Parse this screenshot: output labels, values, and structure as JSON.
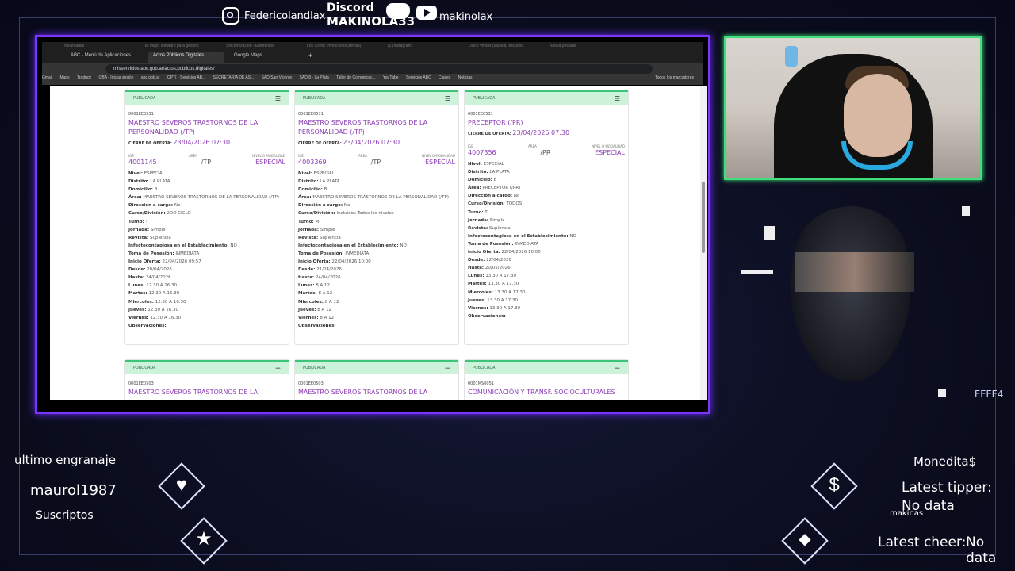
{
  "overlay": {
    "instagram_handle": "Federicolandlax",
    "discord_label": "Discord",
    "discord_handle": "MAKINOLA33",
    "youtube_handle": "makinolax",
    "last_engranaje_label": "ultimo engranaje",
    "last_subscriber": "maurol1987",
    "subscribers_label": "Suscriptos",
    "moneditas_label": "Monedita$",
    "latest_tipper_label": "Latest tipper:",
    "latest_tipper_value": "No data",
    "makinas_label": "makinas",
    "latest_cheer_label": "Latest cheer:",
    "latest_cheer_value": "No data",
    "corner_text": "EEEE4"
  },
  "browser": {
    "tabs": [
      {
        "label": "ABC - Menú de Aplicaciones",
        "active": false
      },
      {
        "label": "Actos Públicos Digitales",
        "active": true
      },
      {
        "label": "Google Maps",
        "active": false
      }
    ],
    "background_tabs": [
      "Novedades",
      "El mejor software para gestión",
      "Sincronización - Elementos",
      "Los Comic Invencibles (temas)",
      "(2) Instagram",
      "Disco Vinilos (Musica) escucha",
      "Nueva pestaña"
    ],
    "new_tab_symbol": "+",
    "url": "misservicios.abc.gob.ar/actos.publicos.digitales/",
    "bookmarks": [
      "Gmail",
      "Maps",
      "Traducir",
      "GBA - Iniciar sesión",
      "abc.gob.ar",
      "OPTI - Servicios AB...",
      "SECRETARÍA DE AS...",
      "SAD San Vicente",
      "SAD 8 - La Plata",
      "Taller de Comunicac...",
      "YouTube",
      "Servicios ABC",
      "Clases",
      "Noticias"
    ],
    "all_bookmarks": "Todos los marcadores"
  },
  "cards": [
    {
      "status": "PUBLICADA",
      "code": "0001EE0531",
      "title": "MAESTRO SEVEROS TRASTORNOS DE LA PERSONALIDAD (/TP)",
      "cierre_label": "CIERRE DE OFERTA:",
      "cierre_date": "23/04/2026 07:30",
      "ige_label": "IGE",
      "area_label": "ÁREA",
      "nivel_label": "NIVEL O MODALIDAD",
      "ige": "4001145",
      "area": "/TP",
      "nivel": "ESPECIAL",
      "details": [
        [
          "Nivel:",
          "ESPECIAL"
        ],
        [
          "Distrito:",
          "LA PLATA"
        ],
        [
          "Domicilio:",
          "B"
        ],
        [
          "Área:",
          "MAESTRO SEVEROS TRASTORNOS DE LA PERSONALIDAD (/TP)"
        ],
        [
          "Dirección a cargo:",
          "No"
        ],
        [
          "Curso/División:",
          "2DO CICLO"
        ],
        [
          "Turno:",
          "T"
        ],
        [
          "Jornada:",
          "Simple"
        ],
        [
          "Revista:",
          "Suplencia"
        ],
        [
          "Infectocontagiosa en el Establecimiento:",
          "NO"
        ],
        [
          "Toma de Posesión:",
          "INMEDIATA"
        ],
        [
          "Inicio Oferta:",
          "22/04/2026 09:57"
        ],
        [
          "Desde:",
          "20/04/2026"
        ],
        [
          "Hasta:",
          "24/04/2026"
        ],
        [
          "Lunes:",
          "12.30 A 16.30"
        ],
        [
          "Martes:",
          "12.30 A 16.30"
        ],
        [
          "Miercoles:",
          "12.30 A 16.30"
        ],
        [
          "Jueves:",
          "12.30 A 16.30"
        ],
        [
          "Viernes:",
          "12.30 A 16.30"
        ],
        [
          "Observaciones:",
          ""
        ]
      ]
    },
    {
      "status": "PUBLICADA",
      "code": "0001EE0531",
      "title": "MAESTRO SEVEROS TRASTORNOS DE LA PERSONALIDAD (/TP)",
      "cierre_label": "CIERRE DE OFERTA:",
      "cierre_date": "23/04/2026 07:30",
      "ige_label": "IGE",
      "area_label": "ÁREA",
      "nivel_label": "NIVEL O MODALIDAD",
      "ige": "4003369",
      "area": "/TP",
      "nivel": "ESPECIAL",
      "details": [
        [
          "Nivel:",
          "ESPECIAL"
        ],
        [
          "Distrito:",
          "LA PLATA"
        ],
        [
          "Domicilio:",
          "B"
        ],
        [
          "Área:",
          "MAESTRO SEVEROS TRASTORNOS DE LA PERSONALIDAD (/TP)"
        ],
        [
          "Dirección a cargo:",
          "No"
        ],
        [
          "Curso/División:",
          "Incluidos Todos los niveles"
        ],
        [
          "Turno:",
          "M"
        ],
        [
          "Jornada:",
          "Simple"
        ],
        [
          "Revista:",
          "Suplencia"
        ],
        [
          "Infectocontagiosa en el Establecimiento:",
          "NO"
        ],
        [
          "Toma de Posesión:",
          "INMEDIATA"
        ],
        [
          "Inicio Oferta:",
          "22/04/2026 10:00"
        ],
        [
          "Desde:",
          "21/04/2026"
        ],
        [
          "Hasta:",
          "24/04/2026"
        ],
        [
          "Lunes:",
          "8 A 12"
        ],
        [
          "Martes:",
          "8 A 12"
        ],
        [
          "Miercoles:",
          "8 A 12"
        ],
        [
          "Jueves:",
          "8 A 12"
        ],
        [
          "Viernes:",
          "8 A 12"
        ],
        [
          "Observaciones:",
          ""
        ]
      ]
    },
    {
      "status": "PUBLICADA",
      "code": "0001EE0531",
      "title": "PRECEPTOR (/PR)",
      "cierre_label": "CIERRE DE OFERTA:",
      "cierre_date": "23/04/2026 07:30",
      "ige_label": "IGE",
      "area_label": "ÁREA",
      "nivel_label": "NIVEL O MODALIDAD",
      "ige": "4007356",
      "area": "/PR",
      "nivel": "ESPECIAL",
      "details": [
        [
          "Nivel:",
          "ESPECIAL"
        ],
        [
          "Distrito:",
          "LA PLATA"
        ],
        [
          "Domicilio:",
          "B"
        ],
        [
          "Área:",
          "PRECEPTOR (/PR)"
        ],
        [
          "Dirección a cargo:",
          "No"
        ],
        [
          "Curso/División:",
          "TODOS"
        ],
        [
          "Turno:",
          "T"
        ],
        [
          "Jornada:",
          "Simple"
        ],
        [
          "Revista:",
          "Suplencia"
        ],
        [
          "Infectocontagiosa en el Establecimiento:",
          "NO"
        ],
        [
          "Toma de Posesión:",
          "INMEDIATA"
        ],
        [
          "Inicio Oferta:",
          "22/04/2026 10:00"
        ],
        [
          "Desde:",
          "22/04/2026"
        ],
        [
          "Hasta:",
          "20/05/2026"
        ],
        [
          "Lunes:",
          "13.30 A 17.30"
        ],
        [
          "Martes:",
          "13.30 A 17.30"
        ],
        [
          "Miercoles:",
          "13.30 A 17.30"
        ],
        [
          "Jueves:",
          "13.30 A 17.30"
        ],
        [
          "Viernes:",
          "13.30 A 17.30"
        ],
        [
          "Observaciones:",
          ""
        ]
      ]
    },
    {
      "status": "PUBLICADA",
      "code": "0001EE0503",
      "title": "MAESTRO SEVEROS TRASTORNOS DE LA"
    },
    {
      "status": "PUBLICADA",
      "code": "0001EE0503",
      "title": "MAESTRO SEVEROS TRASTORNOS DE LA"
    },
    {
      "status": "PUBLICADA",
      "code": "0001MS0051",
      "title": "COMUNICACIÓN Y TRANSF. SOCIOCULTURALES"
    }
  ]
}
